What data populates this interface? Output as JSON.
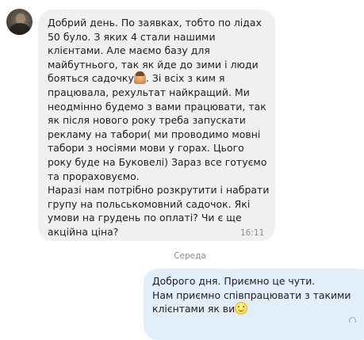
{
  "incoming": {
    "sender_avatar": "user-avatar",
    "text_before_emoji_1": "Добрий день. По заявках, тобто по лідах 50 було. З яких 4 стали нашими клієнтами. Але маємо базу для майбутнього, так як йде до зими і люди бояться садочку",
    "emoji_1": "woman-tipping-hand-emoji",
    "text_after_emoji_1": ". Зі всіх з ким я працювала, рехультат найкращий. Ми неодмінно будемо з вами працювати, так як після нового року треба запускати рекламу на табори( ми проводимо мовні табори з носіями мови у горах. Цього року буде на Буковелі) Зараз все готуємо та прораховуємо.\nНаразі нам потрібно розкрутити і набрати групу на польськомовний садочок. Які умови на грудень по оплаті? Чи є ще акційна ціна?",
    "time": "16:11"
  },
  "date_separator": "Середа",
  "outgoing": {
    "text": "Доброго дня. Приємно це чути.\nНам приємно співпрацювати з такими клієнтами як ви",
    "emoji": "slightly-smiling-face-emoji"
  },
  "colors": {
    "incoming_bubble": "#f1f0f0",
    "outgoing_bubble": "#e3eefb",
    "meta_text": "#8d8d8d"
  }
}
